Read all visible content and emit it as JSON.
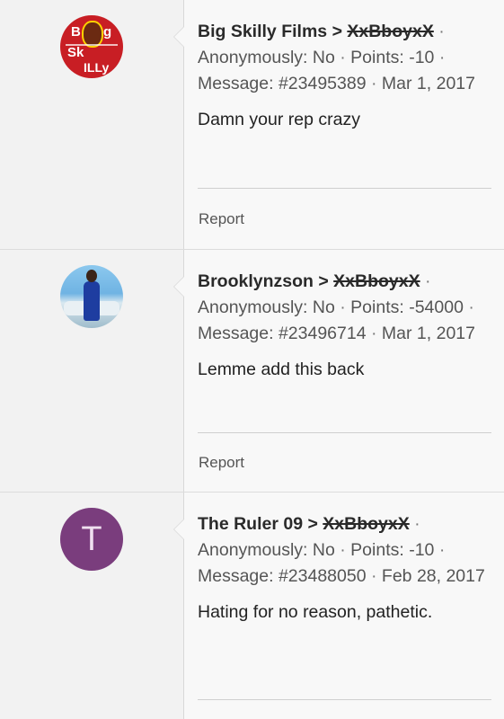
{
  "posts": [
    {
      "author": "Big Skilly Films",
      "recipient": "XxBboyxX",
      "anonymous_label": "Anonymously: No",
      "points_label": "Points: -10",
      "message_id_label": "Message: #23495389",
      "date": "Mar 1, 2017",
      "text": "Damn your rep crazy",
      "report_label": "Report",
      "avatar": {
        "type": "image",
        "letters": [
          "B",
          "g",
          "Sk",
          "ILLy"
        ],
        "bg": "#c81e24"
      }
    },
    {
      "author": "Brooklynzson",
      "recipient": "XxBboyxX",
      "anonymous_label": "Anonymously: No",
      "points_label": "Points: -54000",
      "message_id_label": "Message: #23496714",
      "date": "Mar 1, 2017",
      "text": "Lemme add this back",
      "report_label": "Report",
      "avatar": {
        "type": "photo"
      }
    },
    {
      "author": "The Ruler 09",
      "recipient": "XxBboyxX",
      "anonymous_label": "Anonymously: No",
      "points_label": "Points: -10",
      "message_id_label": "Message: #23488050",
      "date": "Feb 28, 2017",
      "text": "Hating for no reason, pathetic.",
      "report_label": "",
      "avatar": {
        "type": "letter",
        "letter": "T",
        "bg": "#7a3d7d"
      }
    }
  ],
  "arrow_symbol": ">",
  "separator": "·"
}
